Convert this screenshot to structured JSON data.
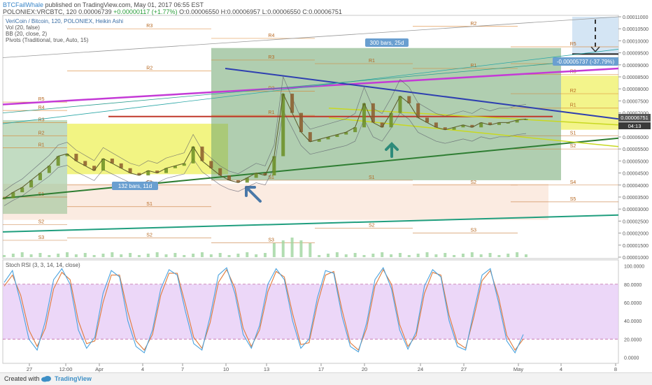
{
  "header": {
    "author": "BTCFailWhale",
    "published": "published on TradingView.com, May 01, 2017 06:55 EST",
    "symbol_line": "POLONIEX:VRCBTC, 120",
    "ohlc_last": "0.00006739",
    "change": "+0.00000117 (+1.77%)",
    "open": "O:0.00006550",
    "high": "H:0.00006957",
    "low": "L:0.00006550",
    "close": "C:0.00006751"
  },
  "legend": {
    "main": "VeriCoin / Bitcoin, 120, POLONIEX, Heikin Ashi",
    "vol": "Vol (20, false)",
    "bb": "BB (20, close, 2)",
    "pivots": "Pivots (Traditional, true, Auto, 15)",
    "stoch": "Stoch RSI (3, 3, 14, 14, close)"
  },
  "annotations": {
    "bars_left": "132 bars, 11d",
    "bars_mid": "300 bars, 25d",
    "measure": "-0.00005737 (-37.79%)",
    "price_badge": "0.00006751",
    "time_badge": "04:13"
  },
  "pivot_labels": [
    "R5",
    "R4",
    "R3",
    "R2",
    "R1",
    "P",
    "S1",
    "S2",
    "S3",
    "S4",
    "S5"
  ],
  "footer": {
    "created": "Created with",
    "brand": "TradingView"
  },
  "colors": {
    "purple_trend": "#c43ad6",
    "blue_trend": "#2e3fb0",
    "green_trend": "#2e7d32",
    "teal_trend": "#1f9e7e",
    "red_level": "#c0392b",
    "candle_up": "#6b8e23",
    "candle_down": "#8b5a2b",
    "stoch_k": "#4aa3df",
    "stoch_d": "#e07a3a",
    "stoch_band": "#e6c9f5"
  },
  "chart_data": [
    {
      "type": "line",
      "title": "VeriCoin / Bitcoin, 120, POLONIEX, Heikin Ashi",
      "x_ticks": [
        "27",
        "12:00",
        "Apr",
        "4",
        "7",
        "10",
        "13",
        "17",
        "20",
        "24",
        "27",
        "May",
        "4",
        "8"
      ],
      "y_ticks": [
        "0.00011000",
        "0.00010500",
        "0.00010000",
        "0.00009500",
        "0.00009000",
        "0.00008500",
        "0.00008000",
        "0.00007500",
        "0.00007000",
        "0.00006500",
        "0.00006000",
        "0.00005500",
        "0.00005000",
        "0.00004500",
        "0.00004000",
        "0.00003500",
        "0.00003000",
        "0.00002500",
        "0.00002000",
        "0.00001500",
        "0.00001000"
      ],
      "ylim": [
        1e-05,
        0.00011
      ],
      "series": [
        {
          "values": [
            3.45e-05,
            3.7e-05,
            3.9e-05,
            4.2e-05,
            4.5e-05,
            4.8e-05,
            5.2e-05,
            5.3e-05,
            5e-05,
            4.8e-05,
            4.6e-05,
            5.1e-05,
            4.9e-05,
            4.7e-05,
            4.5e-05,
            4.4e-05,
            4.6e-05,
            4.5e-05,
            4.7e-05,
            4.8e-05,
            4.9e-05,
            5.6e-05,
            5e-05,
            4.7e-05,
            4.4e-05,
            4.2e-05,
            4.1e-05,
            4.3e-05,
            4.5e-05,
            4.4e-05,
            5.2e-05,
            7.8e-05,
            7e-05,
            6.2e-05,
            5.8e-05,
            5.9e-05,
            6e-05,
            6.1e-05,
            6.2e-05,
            6.4e-05,
            7.4e-05,
            6.6e-05,
            6.4e-05,
            7e-05,
            7.7e-05,
            7.4e-05,
            6.8e-05,
            6.6e-05,
            6.4e-05,
            6.3e-05,
            6.4e-05,
            6.5e-05,
            6.4e-05,
            6.6e-05,
            6.5e-05,
            6.6e-05,
            6.6e-05,
            6.7e-05,
            6.75e-05
          ]
        }
      ]
    },
    {
      "type": "line",
      "title": "Stoch RSI (3, 3, 14, 14, close)",
      "y_ticks": [
        "100.0000",
        "80.0000",
        "60.0000",
        "40.0000",
        "20.0000",
        "0.0000"
      ],
      "ylim": [
        -5,
        102
      ],
      "series": [
        {
          "values": [
            82,
            95,
            60,
            20,
            8,
            40,
            85,
            97,
            80,
            30,
            10,
            22,
            70,
            95,
            88,
            40,
            12,
            5,
            30,
            75,
            96,
            90,
            50,
            15,
            8,
            45,
            90,
            98,
            70,
            25,
            10,
            35,
            80,
            97,
            85,
            40,
            10,
            20,
            65,
            95,
            92,
            45,
            12,
            6,
            38,
            85,
            98,
            75,
            30,
            9,
            28,
            78,
            96,
            88,
            40,
            12,
            8,
            50,
            90,
            97,
            60,
            18,
            5,
            25
          ]
        },
        {
          "values": [
            78,
            90,
            68,
            30,
            12,
            32,
            75,
            93,
            85,
            40,
            15,
            18,
            60,
            90,
            90,
            50,
            18,
            8,
            25,
            68,
            92,
            92,
            58,
            22,
            10,
            38,
            82,
            96,
            76,
            32,
            12,
            30,
            72,
            94,
            88,
            48,
            14,
            16,
            58,
            90,
            94,
            52,
            16,
            8,
            32,
            78,
            96,
            80,
            36,
            12,
            24,
            70,
            93,
            90,
            46,
            16,
            10,
            44,
            84,
            95,
            66,
            24,
            8,
            20
          ]
        }
      ]
    }
  ]
}
